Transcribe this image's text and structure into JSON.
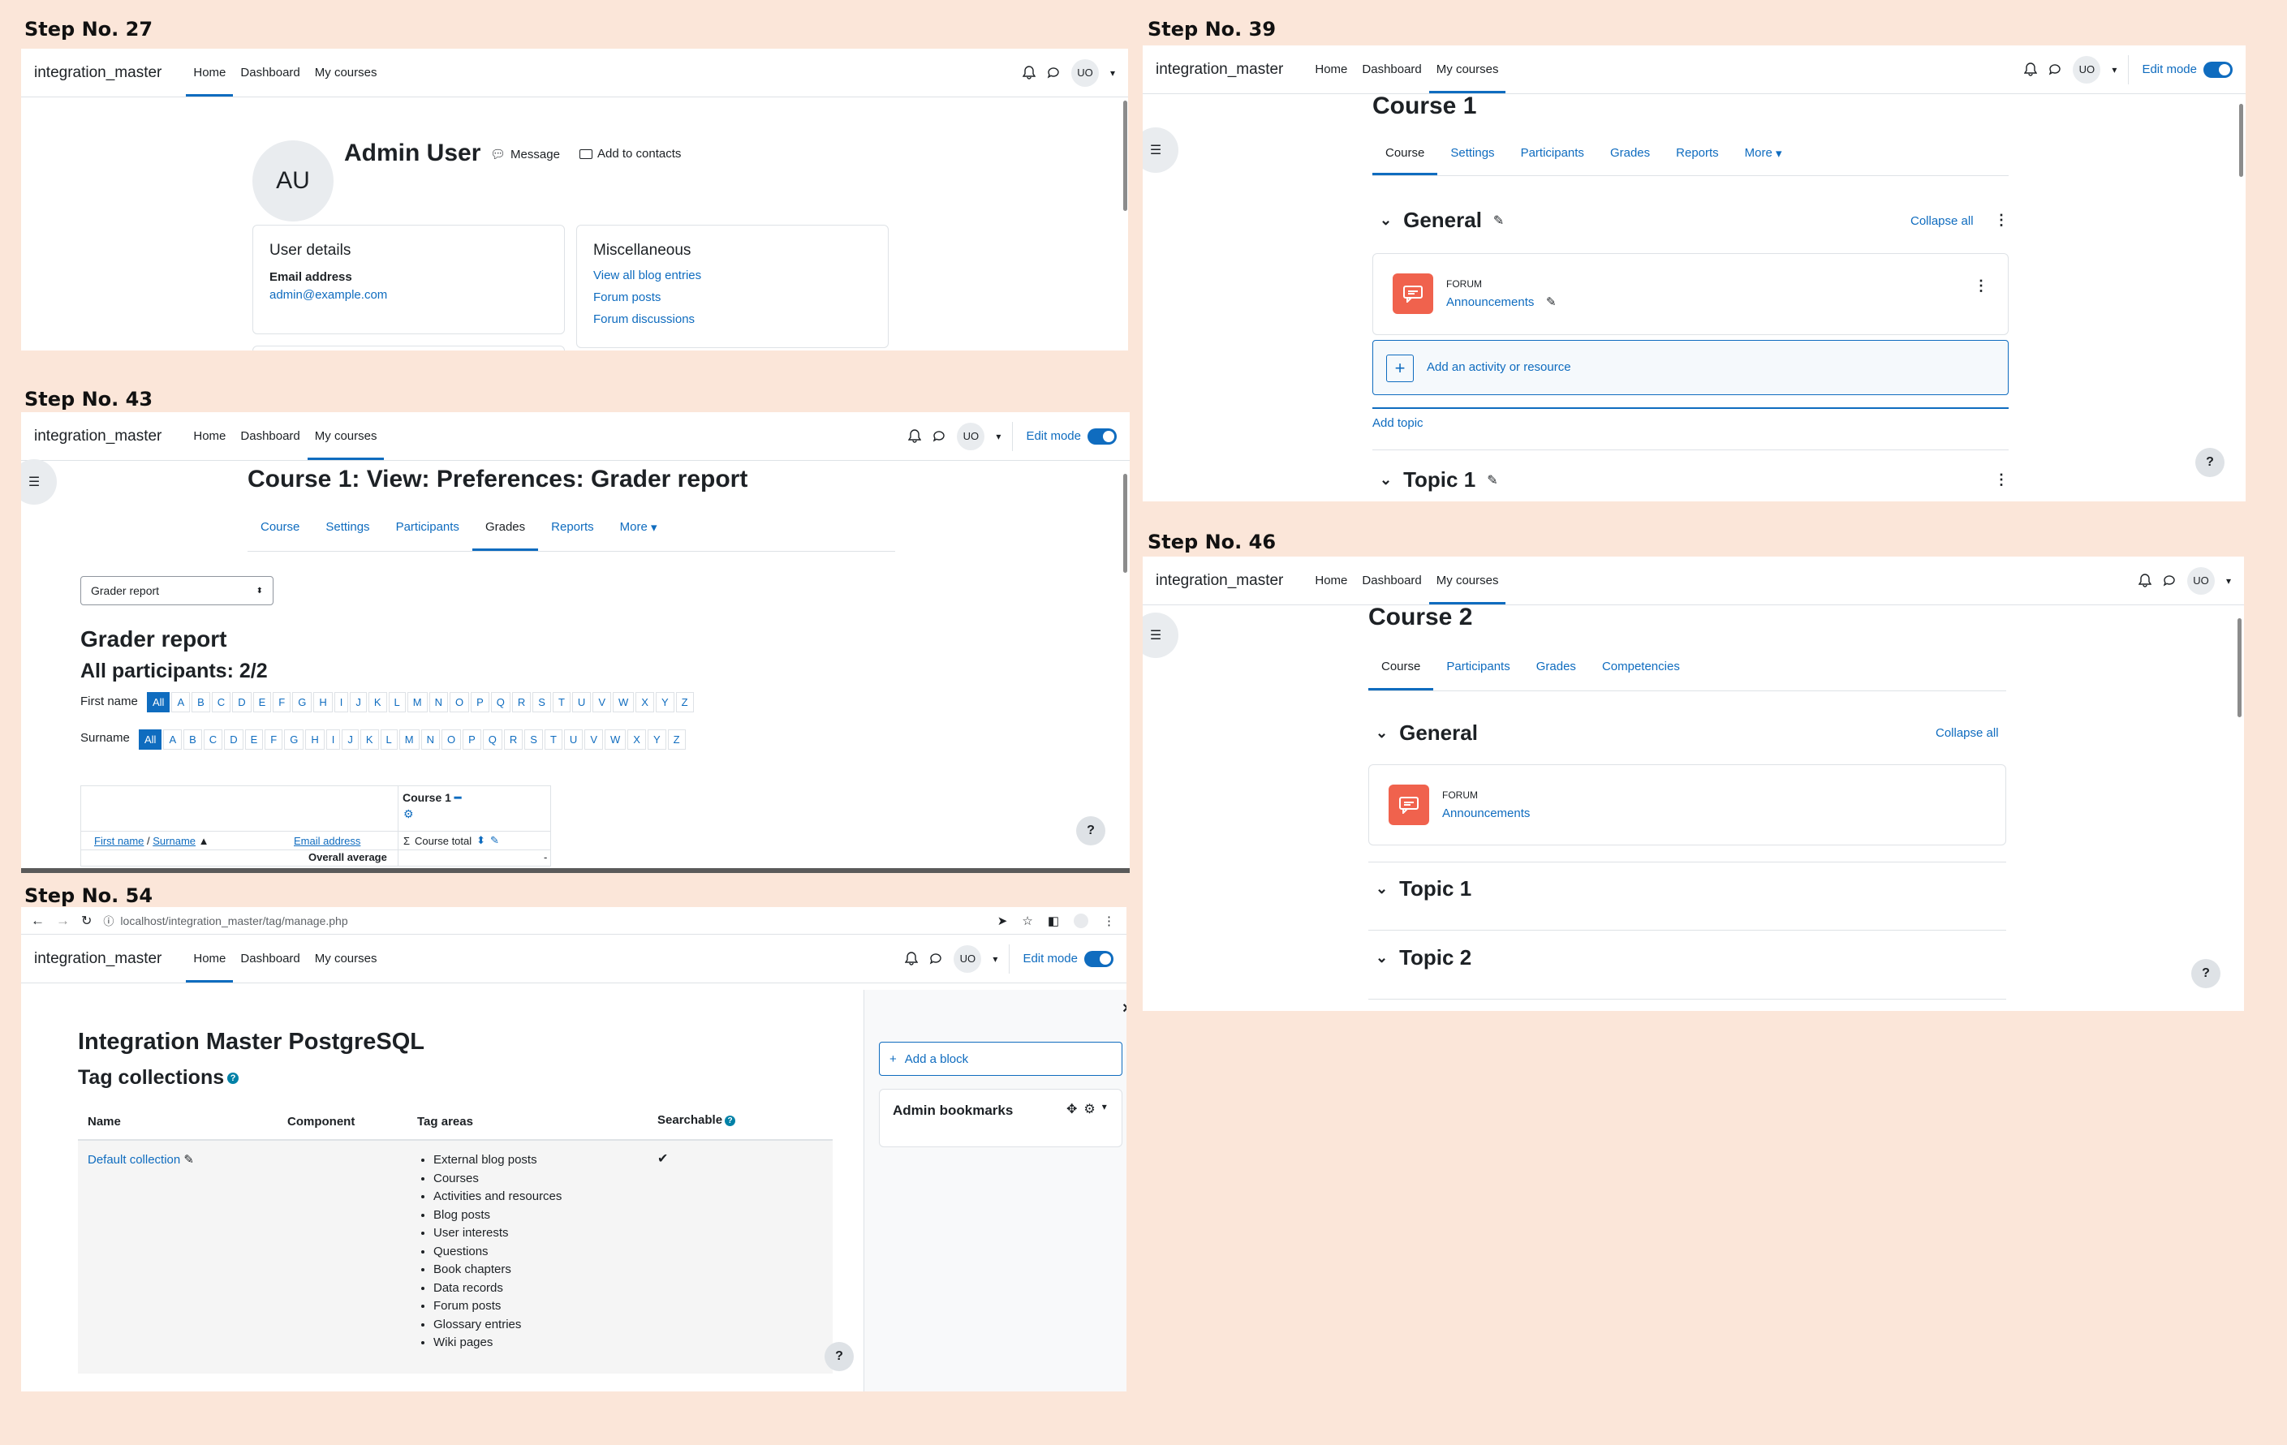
{
  "steps": {
    "s27": {
      "label": "Step No. 27",
      "brand": "integration_master",
      "nav": [
        "Home",
        "Dashboard",
        "My courses"
      ],
      "avatar": "UO",
      "profile_avatar": "AU",
      "user_name": "Admin User",
      "message_label": "Message",
      "contacts_label": "Add to contacts",
      "user_details_title": "User details",
      "email_label": "Email address",
      "email_value": "admin@example.com",
      "misc_title": "Miscellaneous",
      "misc_links": [
        "View all blog entries",
        "Forum posts",
        "Forum discussions"
      ]
    },
    "s39": {
      "label": "Step No. 39",
      "brand": "integration_master",
      "nav": [
        "Home",
        "Dashboard",
        "My courses"
      ],
      "avatar": "UO",
      "edit_mode": "Edit mode",
      "course_title": "Course 1",
      "tabs": [
        "Course",
        "Settings",
        "Participants",
        "Grades",
        "Reports",
        "More"
      ],
      "section_general": "General",
      "collapse_all": "Collapse all",
      "activity_type": "FORUM",
      "activity_name": "Announcements",
      "add_activity": "Add an activity or resource",
      "add_topic": "Add topic",
      "section_topic1": "Topic 1"
    },
    "s43": {
      "label": "Step No. 43",
      "brand": "integration_master",
      "nav": [
        "Home",
        "Dashboard",
        "My courses"
      ],
      "avatar": "UO",
      "edit_mode": "Edit mode",
      "page_title": "Course 1: View: Preferences: Grader report",
      "tabs": [
        "Course",
        "Settings",
        "Participants",
        "Grades",
        "Reports",
        "More"
      ],
      "select_value": "Grader report",
      "heading": "Grader report",
      "subheading": "All participants: 2/2",
      "first_name_label": "First name",
      "surname_label": "Surname",
      "letters": [
        "All",
        "A",
        "B",
        "C",
        "D",
        "E",
        "F",
        "G",
        "H",
        "I",
        "J",
        "K",
        "L",
        "M",
        "N",
        "O",
        "P",
        "Q",
        "R",
        "S",
        "T",
        "U",
        "V",
        "W",
        "X",
        "Y",
        "Z"
      ],
      "col_course": "Course 1",
      "col_first_surname_a": "First name",
      "col_first_surname_sep": " / ",
      "col_first_surname_b": "Surname",
      "col_email": "Email address",
      "col_course_total": "Course total",
      "overall_average": "Overall average",
      "overall_value": "-"
    },
    "s46": {
      "label": "Step No. 46",
      "brand": "integration_master",
      "nav": [
        "Home",
        "Dashboard",
        "My courses"
      ],
      "avatar": "UO",
      "course_title": "Course 2",
      "tabs": [
        "Course",
        "Participants",
        "Grades",
        "Competencies"
      ],
      "section_general": "General",
      "collapse_all": "Collapse all",
      "activity_type": "FORUM",
      "activity_name": "Announcements",
      "section_topic1": "Topic 1",
      "section_topic2": "Topic 2"
    },
    "s54": {
      "label": "Step No. 54",
      "url": "localhost/integration_master/tag/manage.php",
      "brand": "integration_master",
      "nav": [
        "Home",
        "Dashboard",
        "My courses"
      ],
      "avatar": "UO",
      "edit_mode": "Edit mode",
      "site_title": "Integration Master PostgreSQL",
      "section_title": "Tag collections",
      "headers": [
        "Name",
        "Component",
        "Tag areas",
        "Searchable"
      ],
      "row_name": "Default collection",
      "tag_areas": [
        "External blog posts",
        "Courses",
        "Activities and resources",
        "Blog posts",
        "User interests",
        "Questions",
        "Book chapters",
        "Data records",
        "Forum posts",
        "Glossary entries",
        "Wiki pages"
      ],
      "add_block": "Add a block",
      "block_title": "Admin bookmarks"
    }
  },
  "colors": {
    "background": "#fbe6d9",
    "primary": "#0f6cbf",
    "forum": "#f0624d"
  }
}
